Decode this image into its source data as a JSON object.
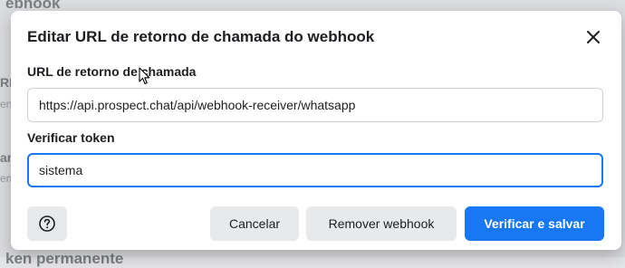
{
  "background": {
    "heading_top": "ebhook",
    "frag_1": "RL",
    "frag_2": "en",
    "frag_3": "ar",
    "frag_4": "en",
    "heading_bottom": "ken permanente"
  },
  "dialog": {
    "title": "Editar URL de retorno de chamada do webhook",
    "close_icon": "close-icon",
    "callback_label": "URL de retorno de chamada",
    "callback_value": "https://api.prospect.chat/api/webhook-receiver/whatsapp",
    "token_label": "Verificar token",
    "token_value": "sistema",
    "help_icon": "question-circle-icon",
    "cancel_label": "Cancelar",
    "remove_label": "Remover webhook",
    "save_label": "Verificar e salvar"
  },
  "colors": {
    "primary": "#1877f2",
    "button_grey": "#e8e9eb",
    "text": "#1c1e21"
  }
}
